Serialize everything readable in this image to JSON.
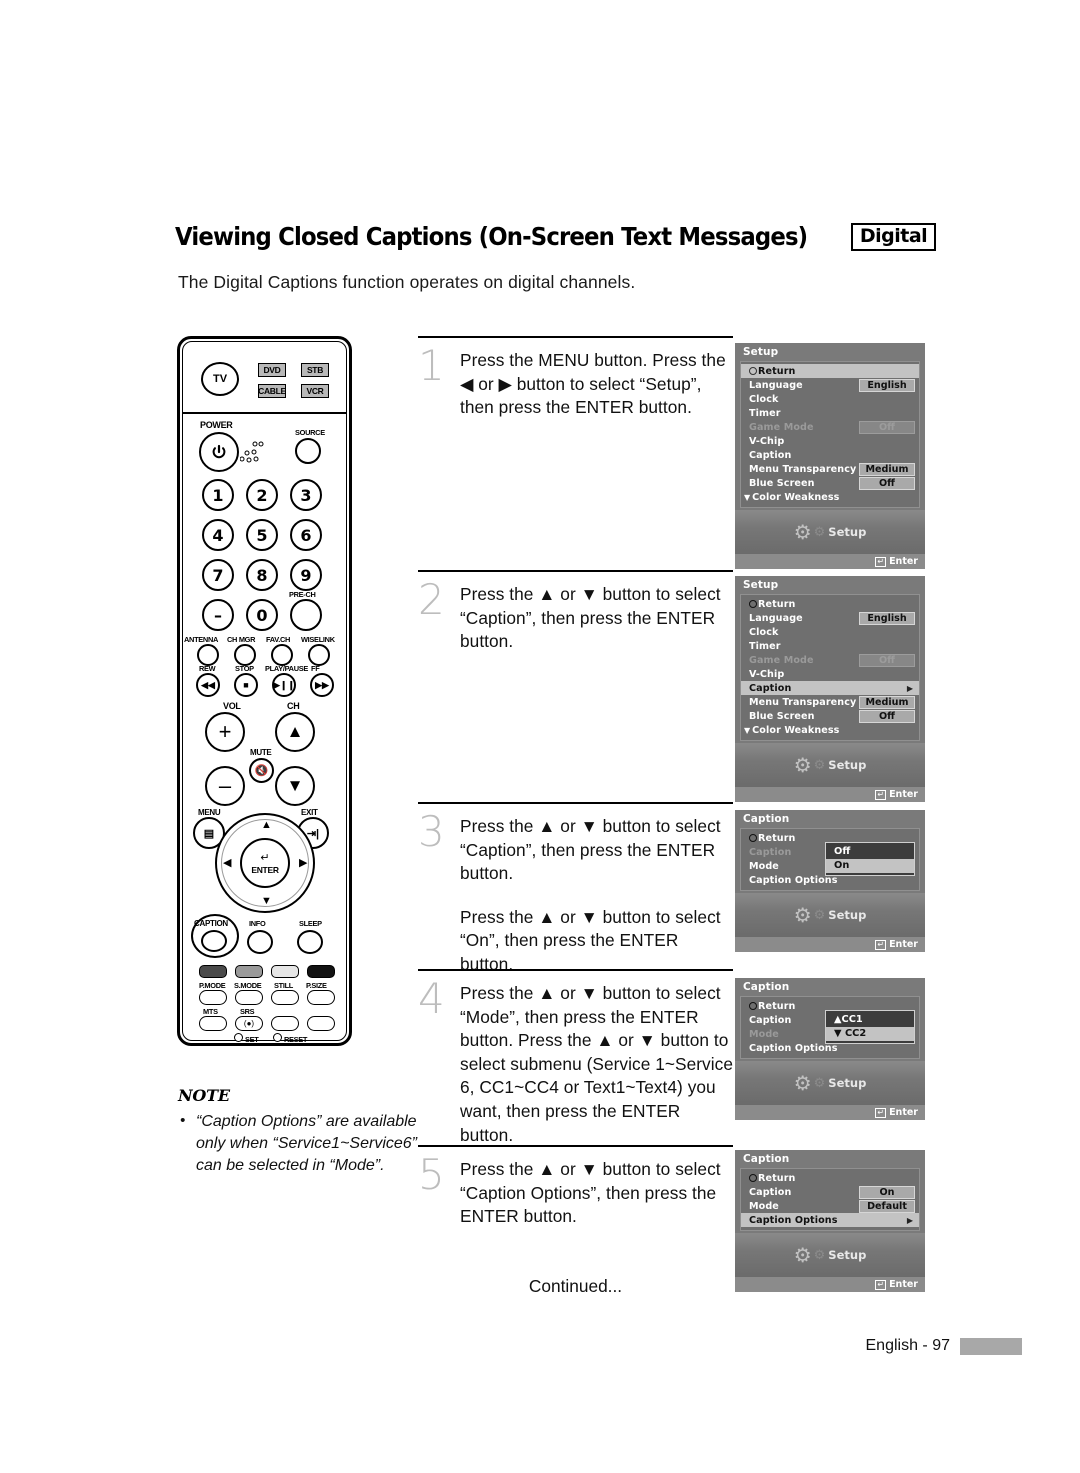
{
  "header": {
    "title": "Viewing Closed Captions (On-Screen Text Messages)",
    "badge": "Digital",
    "intro": "The Digital Captions function operates on digital channels."
  },
  "remote": {
    "device_buttons": [
      "TV",
      "DVD",
      "STB",
      "CABLE",
      "VCR"
    ],
    "power_label": "POWER",
    "source_label": "SOURCE",
    "keypad": [
      "1",
      "2",
      "3",
      "4",
      "5",
      "6",
      "7",
      "8",
      "9",
      "–",
      "0"
    ],
    "prech_label": "PRE-CH",
    "func_labels": [
      "ANTENNA",
      "CH MGR",
      "FAV.CH",
      "WISELINK"
    ],
    "transport_labels": [
      "REW",
      "STOP",
      "PLAY/PAUSE",
      "FF"
    ],
    "vol_label": "VOL",
    "ch_label": "CH",
    "mute_label": "MUTE",
    "menu_label": "MENU",
    "exit_label": "EXIT",
    "enter_label": "ENTER",
    "caption_label": "CAPTION",
    "info_label": "INFO",
    "sleep_label": "SLEEP",
    "mode_labels": [
      "P.MODE",
      "S.MODE",
      "STILL",
      "P.SIZE"
    ],
    "audio_labels": [
      "MTS",
      "SRS"
    ],
    "set_label": "SET",
    "reset_label": "RESET"
  },
  "note": {
    "title": "NOTE",
    "items": [
      "“Caption Options” are available only when “Service1~Service6” can be selected in “Mode”."
    ]
  },
  "steps": [
    {
      "num": "1",
      "paragraphs": [
        "Press the MENU button. Press the ◀ or ▶ button to select “Setup”, then press the ENTER button."
      ]
    },
    {
      "num": "2",
      "paragraphs": [
        "Press the ▲ or ▼ button to select “Caption”, then press the ENTER button."
      ]
    },
    {
      "num": "3",
      "paragraphs": [
        "Press the ▲ or ▼ button to select “Caption”, then press the ENTER button.",
        "Press the ▲ or ▼ button to select “On”, then press the ENTER button."
      ]
    },
    {
      "num": "4",
      "paragraphs": [
        "Press the ▲ or ▼ button to select “Mode”, then press the ENTER button. Press the ▲ or ▼ button to select submenu (Service 1~Service 6, CC1~CC4 or Text1~Text4) you want, then press the ENTER button."
      ]
    },
    {
      "num": "5",
      "paragraphs": [
        "Press the ▲ or ▼ button to select “Caption Options”, then press the ENTER button."
      ]
    }
  ],
  "continued": "Continued...",
  "osd_panels": [
    {
      "title": "Setup",
      "footer_text": "Setup",
      "enter_text": "Enter",
      "rows": [
        {
          "label": "Return",
          "value": null,
          "state": "selected",
          "icon": "return-icon"
        },
        {
          "label": "Language",
          "value": "English",
          "state": "normal"
        },
        {
          "label": "Clock",
          "value": null,
          "state": "normal"
        },
        {
          "label": "Timer",
          "value": null,
          "state": "normal"
        },
        {
          "label": "Game Mode",
          "value": "Off",
          "state": "disabled"
        },
        {
          "label": "V-Chip",
          "value": null,
          "state": "normal"
        },
        {
          "label": "Caption",
          "value": null,
          "state": "normal"
        },
        {
          "label": "Menu Transparency",
          "value": "Medium",
          "state": "normal"
        },
        {
          "label": "Blue Screen",
          "value": "Off",
          "state": "normal"
        },
        {
          "label": "Color Weakness",
          "value": null,
          "state": "normal",
          "caret": "▼"
        }
      ]
    },
    {
      "title": "Setup",
      "footer_text": "Setup",
      "enter_text": "Enter",
      "rows": [
        {
          "label": "Return",
          "value": null,
          "state": "normal",
          "icon": "return-icon"
        },
        {
          "label": "Language",
          "value": "English",
          "state": "normal"
        },
        {
          "label": "Clock",
          "value": null,
          "state": "normal"
        },
        {
          "label": "Timer",
          "value": null,
          "state": "normal"
        },
        {
          "label": "Game Mode",
          "value": "Off",
          "state": "disabled"
        },
        {
          "label": "V-Chip",
          "value": null,
          "state": "normal"
        },
        {
          "label": "Caption",
          "value": null,
          "state": "selected",
          "arrow": "▶"
        },
        {
          "label": "Menu Transparency",
          "value": "Medium",
          "state": "normal"
        },
        {
          "label": "Blue Screen",
          "value": "Off",
          "state": "normal"
        },
        {
          "label": "Color Weakness",
          "value": null,
          "state": "normal",
          "caret": "▼"
        }
      ]
    },
    {
      "title": "Caption",
      "footer_text": "Setup",
      "enter_text": "Enter",
      "rows": [
        {
          "label": "Return",
          "value": null,
          "state": "normal",
          "icon": "return-icon"
        },
        {
          "label": "Caption",
          "value": null,
          "state": "disabled"
        },
        {
          "label": "Mode",
          "value": null,
          "state": "normal"
        },
        {
          "label": "Caption Options",
          "value": null,
          "state": "normal"
        }
      ],
      "popup": {
        "items": [
          {
            "label": "Off",
            "selected": false
          },
          {
            "label": "On",
            "selected": true
          }
        ]
      }
    },
    {
      "title": "Caption",
      "footer_text": "Setup",
      "enter_text": "Enter",
      "rows": [
        {
          "label": "Return",
          "value": null,
          "state": "normal",
          "icon": "return-icon"
        },
        {
          "label": "Caption",
          "value": null,
          "state": "normal"
        },
        {
          "label": "Mode",
          "value": null,
          "state": "disabled"
        },
        {
          "label": "Caption Options",
          "value": null,
          "state": "normal"
        }
      ],
      "popup": {
        "items": [
          {
            "label": "▲CC1",
            "selected": false
          },
          {
            "label": "▼ CC2",
            "selected": true
          }
        ]
      }
    },
    {
      "title": "Caption",
      "footer_text": "Setup",
      "enter_text": "Enter",
      "rows": [
        {
          "label": "Return",
          "value": null,
          "state": "normal",
          "icon": "return-icon"
        },
        {
          "label": "Caption",
          "value": "On",
          "state": "normal"
        },
        {
          "label": "Mode",
          "value": "Default",
          "state": "normal"
        },
        {
          "label": "Caption Options",
          "value": null,
          "state": "selected",
          "arrow": "▶"
        }
      ]
    }
  ],
  "footer": {
    "text": "English - 97"
  }
}
